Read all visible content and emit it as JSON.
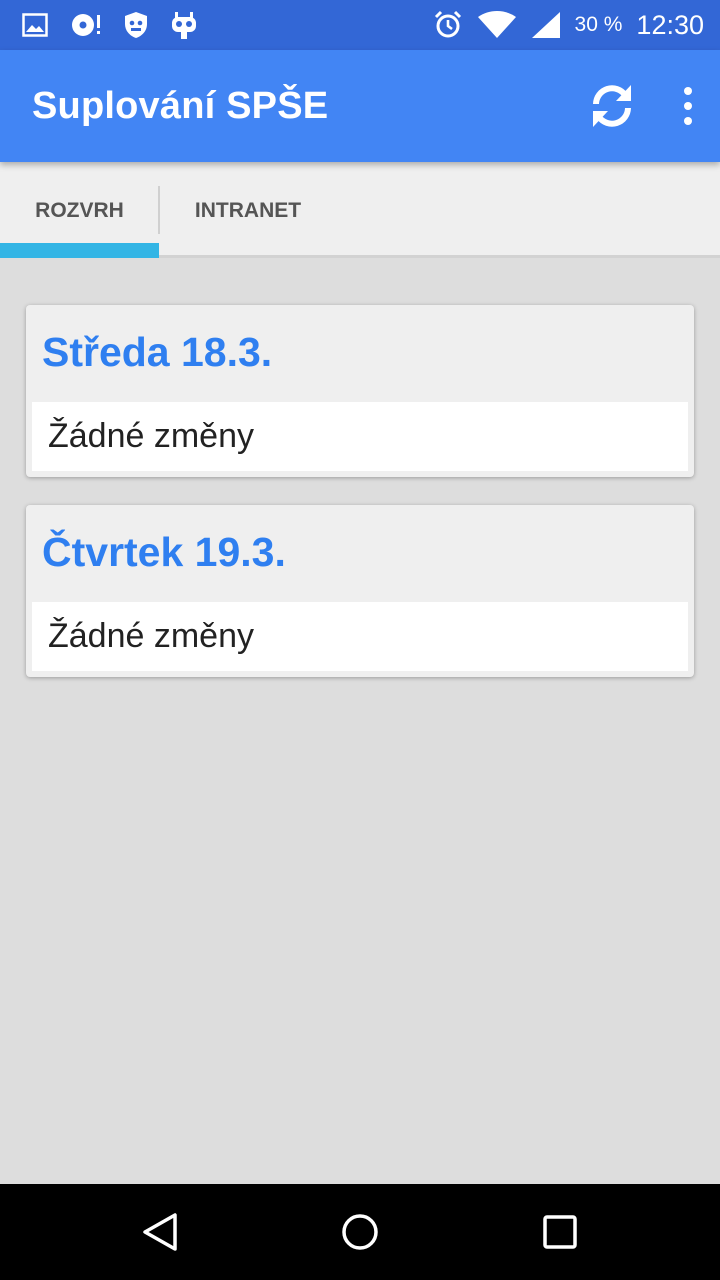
{
  "status_bar": {
    "icons_left": [
      "image-icon",
      "download-icon",
      "shield-icon",
      "cyanogen-icon"
    ],
    "icons_right": [
      "alarm-icon",
      "wifi-icon",
      "signal-icon"
    ],
    "battery": "30 %",
    "time": "12:30"
  },
  "app_bar": {
    "title": "Suplování SPŠE",
    "background": "#4285f4"
  },
  "tabs": [
    {
      "label": "ROZVRH",
      "selected": true
    },
    {
      "label": "INTRANET",
      "selected": false
    }
  ],
  "cards": [
    {
      "title": "Středa 18.3.",
      "body": "Žádné změny"
    },
    {
      "title": "Čtvrtek 19.3.",
      "body": "Žádné změny"
    }
  ],
  "nav_bar": {
    "buttons": [
      "back-icon",
      "home-icon",
      "recent-apps-icon"
    ]
  }
}
